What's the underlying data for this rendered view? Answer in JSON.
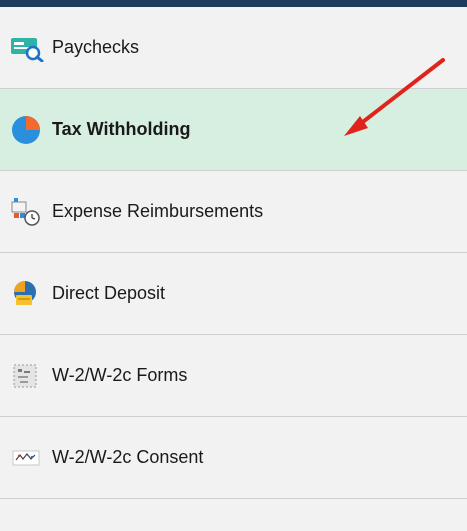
{
  "menu": {
    "items": [
      {
        "label": "Paychecks",
        "icon": "paycheck-icon"
      },
      {
        "label": "Tax Withholding",
        "icon": "pie-chart-icon",
        "active": true
      },
      {
        "label": "Expense Reimbursements",
        "icon": "expense-icon"
      },
      {
        "label": "Direct Deposit",
        "icon": "direct-deposit-icon"
      },
      {
        "label": "W-2/W-2c Forms",
        "icon": "forms-icon"
      },
      {
        "label": "W-2/W-2c Consent",
        "icon": "consent-icon"
      }
    ]
  },
  "colors": {
    "top_bar": "#1f3a5f",
    "active_bg": "#d6efe1",
    "arrow": "#e0241b"
  }
}
